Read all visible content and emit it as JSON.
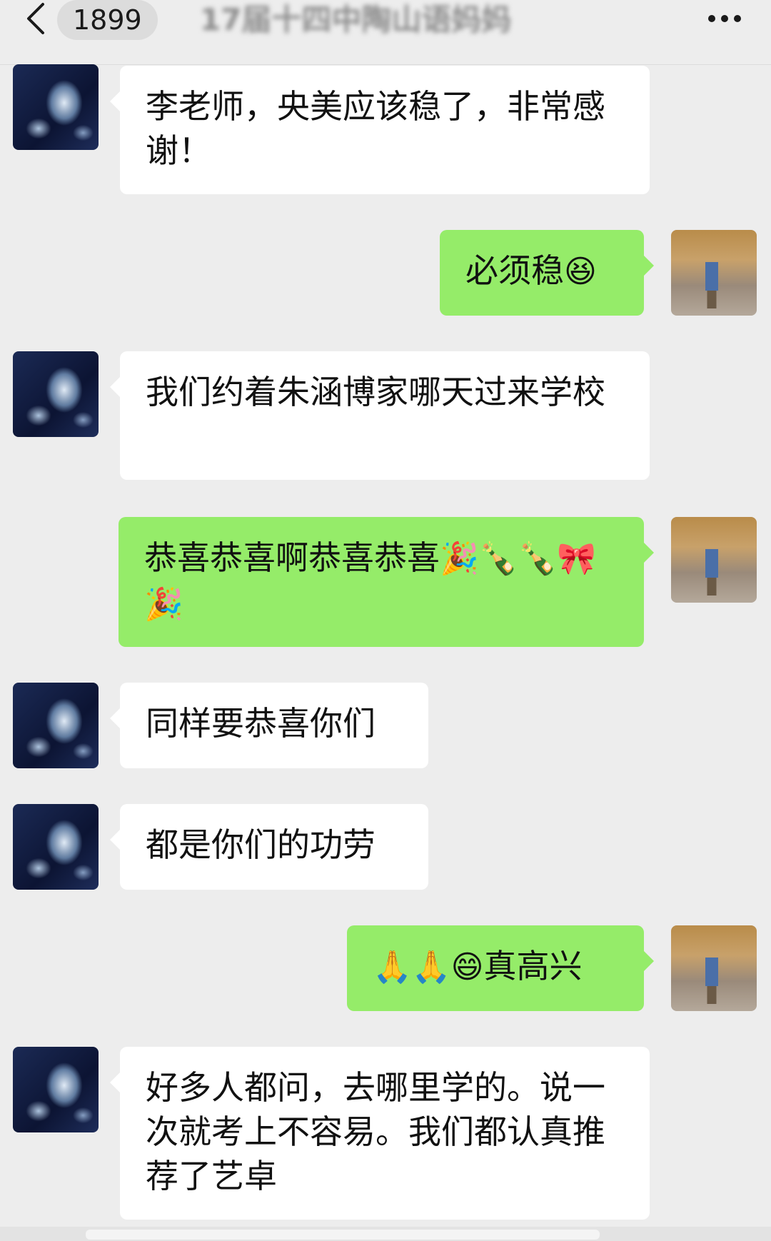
{
  "header": {
    "unread_count": "1899",
    "chat_title": "17届十四中陶山语妈妈"
  },
  "messages": [
    {
      "side": "left",
      "text": "李老师，央美应该稳了，非常感谢！"
    },
    {
      "side": "right",
      "text": "必须稳",
      "emoji": "😆"
    },
    {
      "side": "left",
      "text": "我们约着朱涵博家哪天过来学校"
    },
    {
      "side": "right",
      "text": "恭喜恭喜啊恭喜恭喜",
      "emoji": "🎉🍾🍾🎀🎉"
    },
    {
      "side": "left",
      "text": "同样要恭喜你们"
    },
    {
      "side": "left",
      "text": "都是你们的功劳"
    },
    {
      "side": "right",
      "prefix_emoji": "🙏🙏😄",
      "text": "真高兴"
    },
    {
      "side": "left",
      "text": "好多人都问，去哪里学的。说一次就考上不容易。我们都认真推荐了艺卓"
    }
  ]
}
